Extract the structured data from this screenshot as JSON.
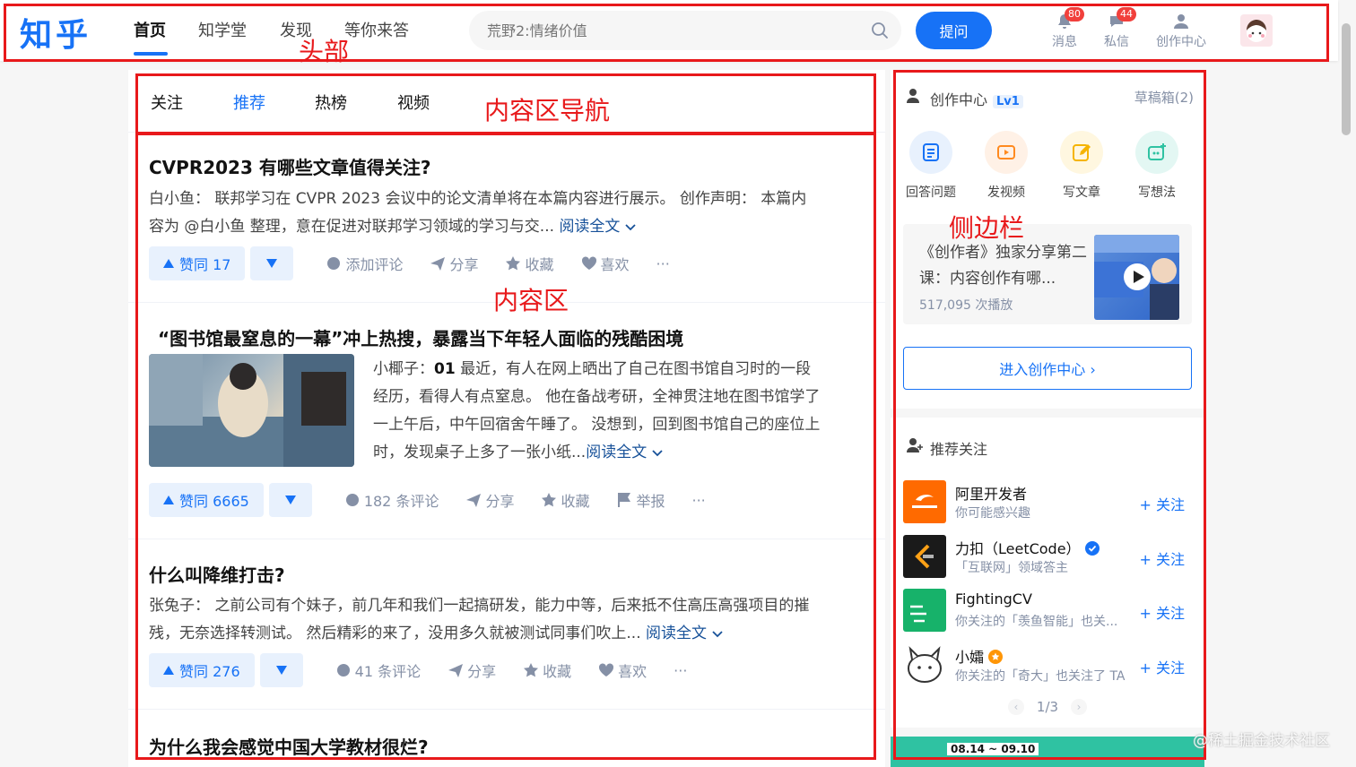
{
  "header": {
    "logo": "知乎",
    "nav": [
      "首页",
      "知学堂",
      "发现",
      "等你来答"
    ],
    "search_placeholder": "荒野2:情绪价值",
    "ask_label": "提问",
    "messages_label": "消息",
    "messages_badge": "80",
    "dm_label": "私信",
    "dm_badge": "44",
    "creator_label": "创作中心"
  },
  "annotations": {
    "header": "头部",
    "content_nav": "内容区导航",
    "content": "内容区",
    "sidebar": "侧边栏"
  },
  "tabs": [
    "关注",
    "推荐",
    "热榜",
    "视频"
  ],
  "feed": [
    {
      "title": "CVPR2023 有哪些文章值得关注?",
      "excerpt_line1": "白小鱼：  联邦学习在 CVPR 2023 会议中的论文清单将在本篇内容进行展示。 创作声明：  本篇内",
      "excerpt_line2": "容为 @白小鱼 整理，意在促进对联邦学习领域的学习与交...",
      "read_more": "阅读全文",
      "vote": "赞同 17",
      "comment": "添加评论",
      "share": "分享",
      "fav": "收藏",
      "like": "喜欢",
      "more": "···"
    },
    {
      "title": "“图书馆最窒息的一幕”冲上热搜，暴露当下年轻人面临的残酷困境",
      "excerpt_author": "小椰子：",
      "excerpt_bold": "01",
      "excerpt_line1": " 最近，有人在网上晒出了自己在图书馆自习时的一段",
      "excerpt_line2": "经历，看得人有点窒息。 他在备战考研，全神贯注地在图书馆学了",
      "excerpt_line3": "一上午后，中午回宿舍午睡了。 没想到，回到图书馆自己的座位上",
      "excerpt_line4": "时，发现桌子上多了一张小纸...",
      "read_more": "阅读全文",
      "vote": "赞同 6665",
      "comment": "182 条评论",
      "share": "分享",
      "fav": "收藏",
      "report": "举报",
      "more": "···"
    },
    {
      "title": "什么叫降维打击?",
      "excerpt_line1": "张兔子：  之前公司有个妹子，前几年和我们一起搞研发，能力中等，后来抵不住高压高强项目的摧",
      "excerpt_line2": "残，无奈选择转测试。 然后精彩的来了，没用多久就被测试同事们吹上...",
      "read_more": "阅读全文",
      "vote": "赞同 276",
      "comment": "41 条评论",
      "share": "分享",
      "fav": "收藏",
      "like": "喜欢",
      "more": "···"
    },
    {
      "title": "为什么我会感觉中国大学教材很烂?"
    }
  ],
  "sidebar": {
    "creator_title": "创作中心",
    "level": "Lv1",
    "drafts": "草稿箱(2)",
    "tools": [
      "回答问题",
      "发视频",
      "写文章",
      "写想法"
    ],
    "promo_title": "《创作者》独家分享第二课：内容创作有哪...",
    "promo_plays": "517,095 次播放",
    "enter_label": "进入创作中心 ›",
    "rec_title": "推荐关注",
    "recommendations": [
      {
        "name": "阿里开发者",
        "desc": "你可能感兴趣"
      },
      {
        "name": "力扣（LeetCode）",
        "desc": "「互联网」领域答主"
      },
      {
        "name": "FightingCV",
        "desc": "你关注的「羡鱼智能」也关..."
      },
      {
        "name": "小孀",
        "desc": "你关注的「奇大」也关注了 TA"
      }
    ],
    "follow_label": "+ 关注",
    "pager": "1/3",
    "banner_date": "08.14 ~ 09.10"
  },
  "watermark": "@稀土掘金技术社区",
  "colors": {
    "brand": "#1772f6",
    "annotation": "#e8191b",
    "badge": "#f1403c"
  }
}
